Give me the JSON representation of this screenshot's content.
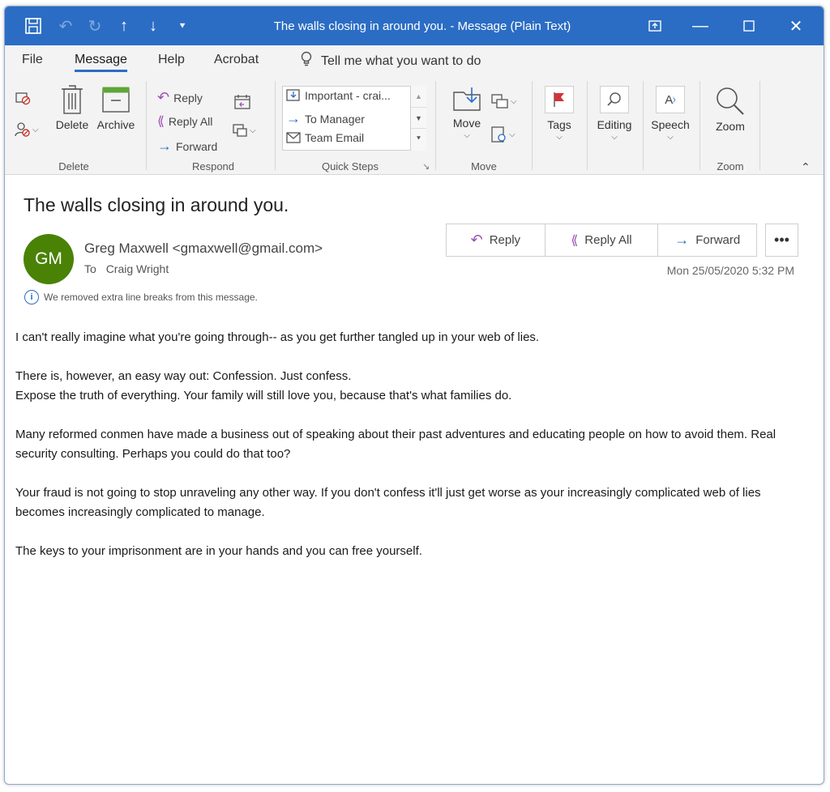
{
  "window": {
    "title": "The walls closing in around you.  -  Message (Plain Text)",
    "accent": "#2b6dc4"
  },
  "menu": {
    "tabs": [
      {
        "label": "File"
      },
      {
        "label": "Message"
      },
      {
        "label": "Help"
      },
      {
        "label": "Acrobat"
      }
    ],
    "tell_me": "Tell me what you want to do"
  },
  "ribbon": {
    "delete_group": {
      "delete_label": "Delete",
      "archive_label": "Archive",
      "group_label": "Delete"
    },
    "respond_group": {
      "reply": "Reply",
      "reply_all": "Reply All",
      "forward": "Forward",
      "group_label": "Respond"
    },
    "quick_steps": {
      "items": [
        "Important - crai...",
        "To Manager",
        "Team Email"
      ],
      "group_label": "Quick Steps"
    },
    "move_group": {
      "move_label": "Move",
      "group_label": "Move"
    },
    "tags_label": "Tags",
    "editing_label": "Editing",
    "speech_label": "Speech",
    "zoom_group": {
      "zoom_label": "Zoom",
      "group_label": "Zoom"
    }
  },
  "message": {
    "subject": "The walls closing in around you.",
    "avatar_initials": "GM",
    "avatar_color": "#498205",
    "sender": "Greg Maxwell <gmaxwell@gmail.com>",
    "to_label": "To",
    "recipient": "Craig Wright",
    "datetime": "Mon 25/05/2020 5:32 PM",
    "actions": {
      "reply": "Reply",
      "reply_all": "Reply All",
      "forward": "Forward",
      "more": "•••"
    },
    "info_note": "We removed extra line breaks from this message.",
    "body": {
      "p1": "I can't really imagine what you're going through-- as you get further tangled up in your web of lies.",
      "p2a": "There is, however, an easy way out:  Confession.  Just confess.",
      "p2b": "Expose the truth of everything.  Your family will still love you, because that's what families do.",
      "p3": "Many reformed conmen have made a business out of speaking about their past adventures and educating people on how to avoid them. Real security consulting. Perhaps you could do that too?",
      "p4": "Your fraud is not going to stop unraveling any other way. If you don't confess it'll just get worse as your increasingly complicated web of lies becomes increasingly complicated to manage.",
      "p5": "The keys to your imprisonment are in your hands and you can free yourself."
    }
  }
}
